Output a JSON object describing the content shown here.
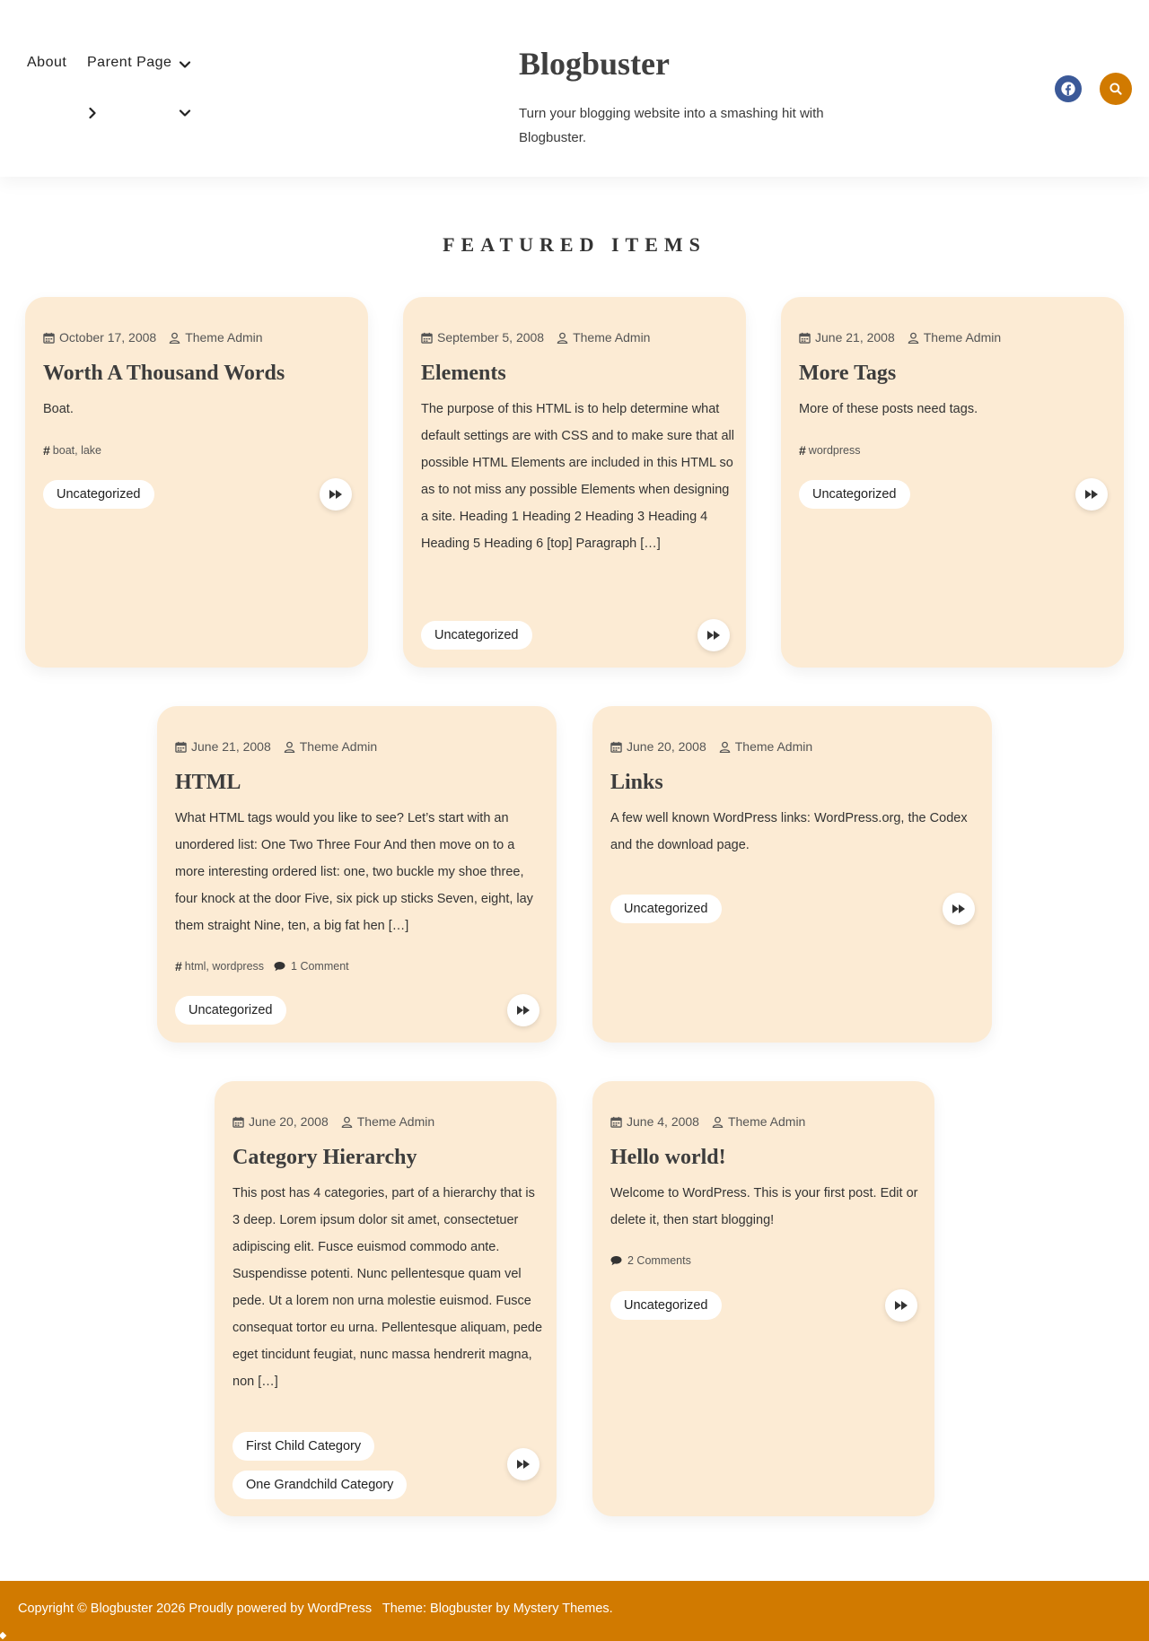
{
  "header": {
    "nav": [
      {
        "label": "About"
      },
      {
        "label": "Parent Page"
      }
    ],
    "site_title": "Blogbuster",
    "tagline": "Turn your blogging website into a smashing hit with Blogbuster.",
    "social_icon": "facebook-icon",
    "search_icon": "search-icon",
    "colors": {
      "accent": "#d17a00",
      "facebook": "#3b5998"
    }
  },
  "section": {
    "title": "FEATURED ITEMS"
  },
  "posts": [
    {
      "date": "October 17, 2008",
      "author": "Theme Admin",
      "title": "Worth A Thousand Words",
      "excerpt": "Boat.",
      "tags": "boat, lake",
      "comments": "",
      "categories": [
        "Uncategorized"
      ]
    },
    {
      "date": "September 5, 2008",
      "author": "Theme Admin",
      "title": "Elements",
      "excerpt": "The purpose of this HTML is to help determine what default settings are with CSS and to make sure that all possible HTML Elements are included in this HTML so as to not miss any possible Elements when designing a site. Heading 1 Heading 2 Heading 3 Heading 4 Heading 5 Heading 6 [top] Paragraph […]",
      "tags": "",
      "comments": "",
      "categories": [
        "Uncategorized"
      ]
    },
    {
      "date": "June 21, 2008",
      "author": "Theme Admin",
      "title": "More Tags",
      "excerpt": "More of these posts need tags.",
      "tags": "wordpress",
      "comments": "",
      "categories": [
        "Uncategorized"
      ]
    },
    {
      "date": "June 21, 2008",
      "author": "Theme Admin",
      "title": "HTML",
      "excerpt": "What HTML tags would you like to see? Let’s start with an unordered list: One Two Three Four And then move on to a more interesting ordered list: one, two buckle my shoe three, four knock at the door Five, six pick up sticks Seven, eight, lay them straight Nine, ten, a big fat hen […]",
      "tags": "html, wordpress",
      "comments": "1 Comment",
      "categories": [
        "Uncategorized"
      ]
    },
    {
      "date": "June 20, 2008",
      "author": "Theme Admin",
      "title": "Links",
      "excerpt": "A few well known WordPress links: WordPress.org, the Codex and the download page.",
      "tags": "",
      "comments": "",
      "categories": [
        "Uncategorized"
      ]
    },
    {
      "date": "June 20, 2008",
      "author": "Theme Admin",
      "title": "Category Hierarchy",
      "excerpt": "This post has 4 categories, part of a hierarchy that is 3 deep. Lorem ipsum dolor sit amet, consectetuer adipiscing elit. Fusce euismod commodo ante. Suspendisse potenti. Nunc pellentesque quam vel pede. Ut a lorem non urna molestie euismod. Fusce consequat tortor eu urna. Pellentesque aliquam, pede eget tincidunt feugiat, nunc massa hendrerit magna, non […]",
      "tags": "",
      "comments": "",
      "categories": [
        "First Child Category",
        "One Grandchild Category"
      ]
    },
    {
      "date": "June 4, 2008",
      "author": "Theme Admin",
      "title": "Hello world!",
      "excerpt": "Welcome to WordPress. This is your first post. Edit or delete it, then start blogging!",
      "tags": "",
      "comments": "2 Comments",
      "categories": [
        "Uncategorized"
      ]
    }
  ],
  "footer": {
    "copyright": "Copyright © Blogbuster 2026 Proudly powered by WordPress",
    "theme": "Theme: Blogbuster by Mystery Themes."
  }
}
